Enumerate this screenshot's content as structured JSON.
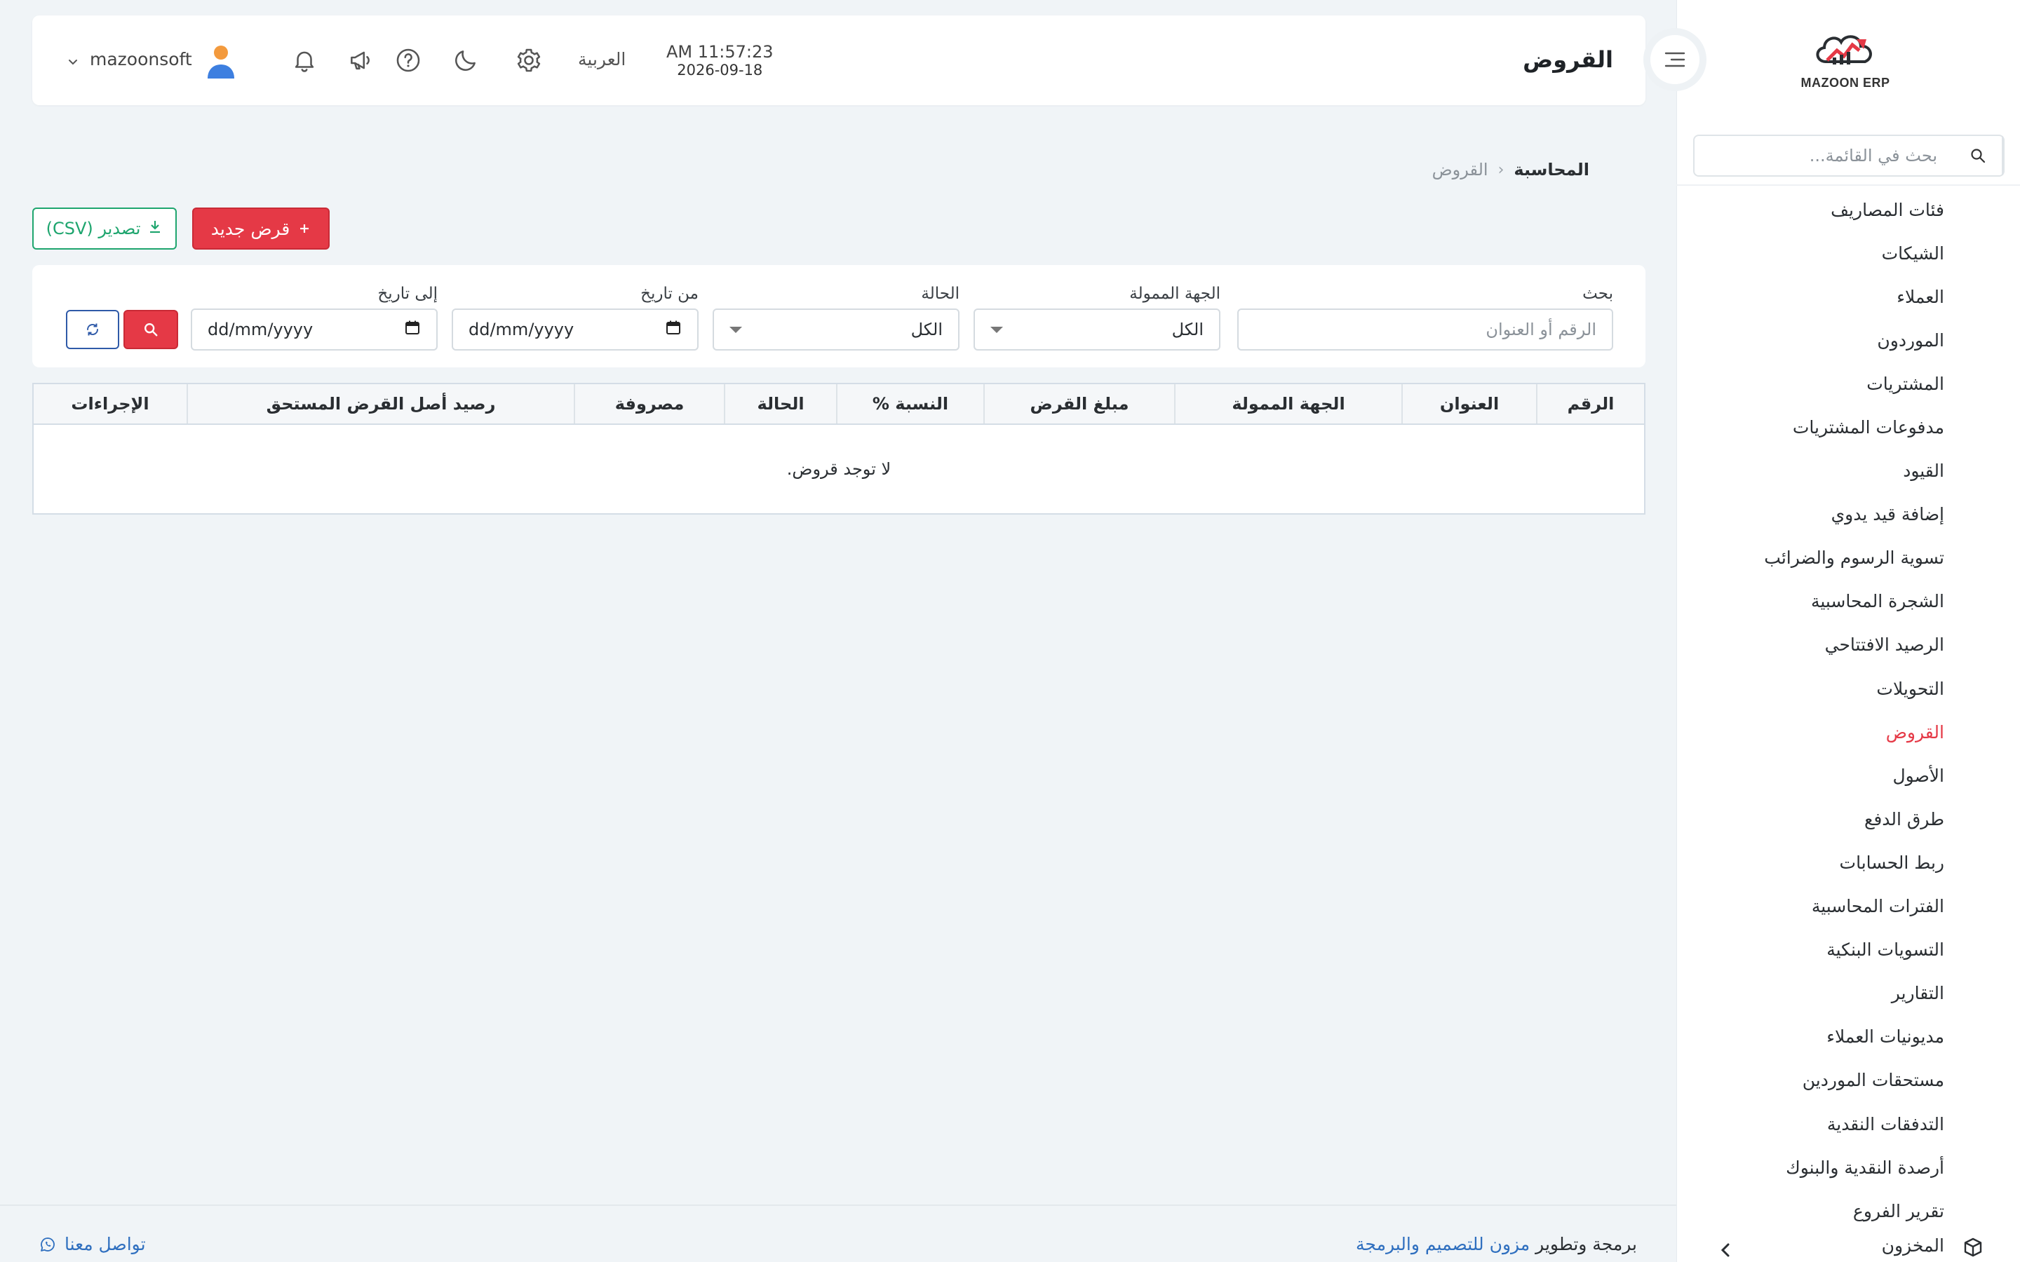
{
  "app": {
    "logo_text": "MAZOON ERP",
    "accent_color": "#e53946",
    "success_color": "#1ea56e"
  },
  "sidebar": {
    "search_placeholder": "بحث في القائمة...",
    "items": [
      {
        "label": "فئات المصاريف",
        "active": false
      },
      {
        "label": "الشيكات",
        "active": false
      },
      {
        "label": "العملاء",
        "active": false
      },
      {
        "label": "الموردون",
        "active": false
      },
      {
        "label": "المشتريات",
        "active": false
      },
      {
        "label": "مدفوعات المشتريات",
        "active": false
      },
      {
        "label": "القيود",
        "active": false
      },
      {
        "label": "إضافة قيد يدوي",
        "active": false
      },
      {
        "label": "تسوية الرسوم والضرائب",
        "active": false
      },
      {
        "label": "الشجرة المحاسبية",
        "active": false
      },
      {
        "label": "الرصيد الافتتاحي",
        "active": false
      },
      {
        "label": "التحويلات",
        "active": false
      },
      {
        "label": "القروض",
        "active": true
      },
      {
        "label": "الأصول",
        "active": false
      },
      {
        "label": "طرق الدفع",
        "active": false
      },
      {
        "label": "ربط الحسابات",
        "active": false
      },
      {
        "label": "الفترات المحاسبية",
        "active": false
      },
      {
        "label": "التسويات البنكية",
        "active": false
      },
      {
        "label": "التقارير",
        "active": false
      },
      {
        "label": "مديونيات العملاء",
        "active": false
      },
      {
        "label": "مستحقات الموردين",
        "active": false
      },
      {
        "label": "التدفقات النقدية",
        "active": false
      },
      {
        "label": "أرصدة النقدية والبنوك",
        "active": false
      },
      {
        "label": "تقرير الفروع",
        "active": false
      }
    ],
    "bottom_group": {
      "label": "المخزون",
      "icon": "box-icon"
    }
  },
  "header": {
    "title": "القروض",
    "time": "AM 11:57:23",
    "date": "2026-09-18",
    "language": "العربية",
    "username": "mazoonsoft"
  },
  "breadcrumb": {
    "root": "المحاسبة",
    "separator": "‹",
    "current": "القروض"
  },
  "actions": {
    "new_label": "قرض جديد",
    "export_label": "تصدير (CSV)"
  },
  "filters": {
    "search_label": "بحث",
    "search_placeholder": "الرقم أو العنوان",
    "lender_label": "الجهة الممولة",
    "lender_value": "الكل",
    "status_label": "الحالة",
    "status_value": "الكل",
    "from_label": "من تاريخ",
    "from_placeholder": "dd/mm/yyyy",
    "to_label": "إلى تاريخ",
    "to_placeholder": "dd/mm/yyyy"
  },
  "table": {
    "columns": [
      "الرقم",
      "العنوان",
      "الجهة الممولة",
      "مبلغ القرض",
      "النسبة %",
      "الحالة",
      "مصروفة",
      "رصيد أصل القرض المستحق",
      "الإجراءات"
    ],
    "empty_message": "لا توجد قروض."
  },
  "footer": {
    "credit_prefix": "برمجة وتطوير",
    "credit_link": "مزون للتصميم والبرمجة",
    "contact": "تواصل معنا"
  }
}
